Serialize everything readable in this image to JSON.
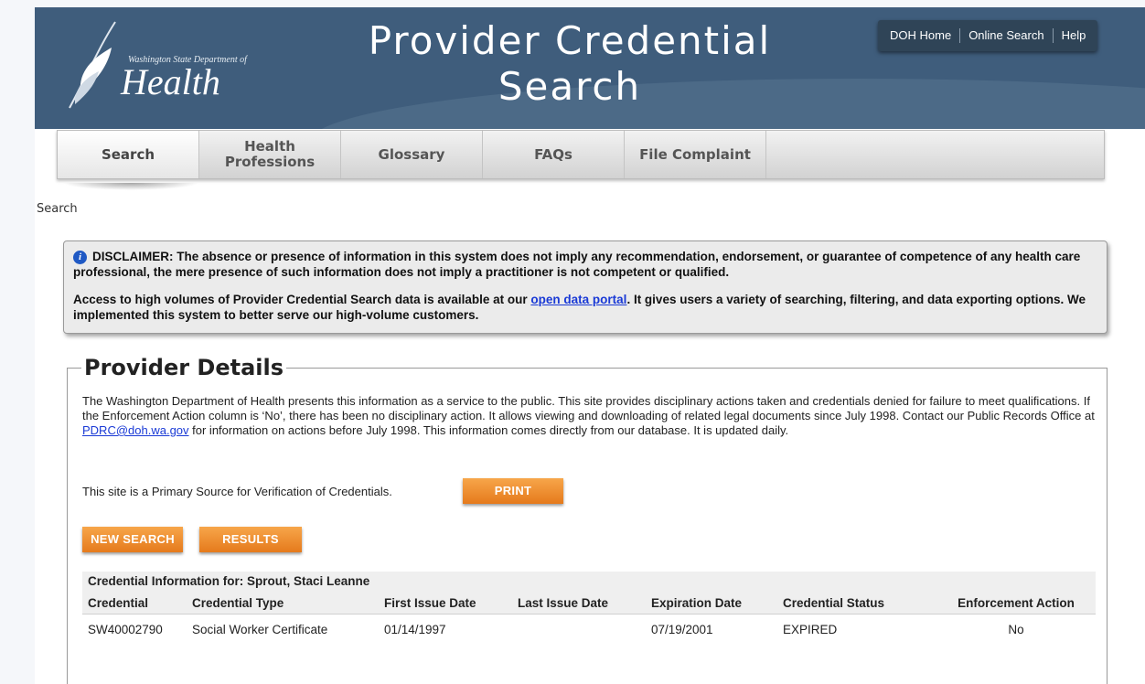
{
  "header": {
    "logo_small": "Washington State Department of",
    "logo_big": "Health",
    "title": "Provider Credential Search",
    "top_links": [
      "DOH Home",
      "Online Search",
      "Help"
    ]
  },
  "nav": {
    "tabs": [
      {
        "label": "Search",
        "active": true
      },
      {
        "label": "Health Professions",
        "active": false
      },
      {
        "label": "Glossary",
        "active": false
      },
      {
        "label": "FAQs",
        "active": false
      },
      {
        "label": "File Complaint",
        "active": false
      }
    ]
  },
  "breadcrumb": "Search",
  "disclaimer": {
    "p1": "DISCLAIMER: The absence or presence of information in this system does not imply any recommendation, endorsement, or guarantee of competence of any health care professional, the mere presence of such information does not imply a practitioner is not competent or qualified.",
    "p2_before": "Access to high volumes of Provider Credential Search data is available at our ",
    "p2_link": "open data portal",
    "p2_after": ". It gives users a variety of searching, filtering, and data exporting options. We implemented this system to better serve our high-volume customers."
  },
  "details": {
    "legend": "Provider Details",
    "intro_before": "The Washington Department of Health presents this information as a service to the public. This site provides disciplinary actions taken and credentials denied for failure to meet qualifications. If the Enforcement Action column is ‘No’, there has been no disciplinary action. It allows viewing and downloading of related legal documents since July 1998. Contact our Public Records Office at ",
    "intro_link": "PDRC@doh.wa.gov",
    "intro_after": " for information on actions before July 1998. This information comes directly from our database. It is updated daily.",
    "primary_source": "This site is a Primary Source for Verification of Credentials.",
    "print_label": "PRINT",
    "new_search_label": "NEW SEARCH",
    "results_label": "RESULTS"
  },
  "credentials": {
    "caption": "Credential Information for: Sprout, Staci Leanne",
    "columns": [
      "Credential",
      "Credential Type",
      "First Issue Date",
      "Last Issue Date",
      "Expiration Date",
      "Credential Status",
      "Enforcement Action"
    ],
    "rows": [
      [
        "SW40002790",
        "Social Worker Certificate",
        "01/14/1997",
        "",
        "07/19/2001",
        "EXPIRED",
        "No"
      ]
    ]
  },
  "colors": {
    "banner": "#3f5d7c",
    "accent_orange": "#e57a1c",
    "link": "#1a3ad6"
  }
}
